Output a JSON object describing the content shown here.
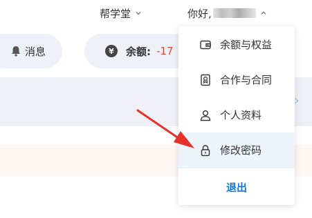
{
  "header": {
    "help_label": "帮学堂",
    "user_greeting": "你好,"
  },
  "stats": {
    "messages_label": "消息",
    "balance_label": "余额:",
    "balance_value": "-17"
  },
  "user_menu": {
    "items": [
      {
        "label": "余额与权益",
        "icon": "wallet-icon"
      },
      {
        "label": "合作与合同",
        "icon": "contract-icon"
      },
      {
        "label": "个人资料",
        "icon": "user-icon"
      },
      {
        "label": "修改密码",
        "icon": "lock-icon",
        "highlighted": true
      }
    ],
    "logout_label": "退出"
  },
  "colors": {
    "accent": "#1677d2",
    "balance_negative": "#e5483b",
    "annotation_arrow": "#e8312a",
    "highlight_bg": "#eef4fc"
  }
}
